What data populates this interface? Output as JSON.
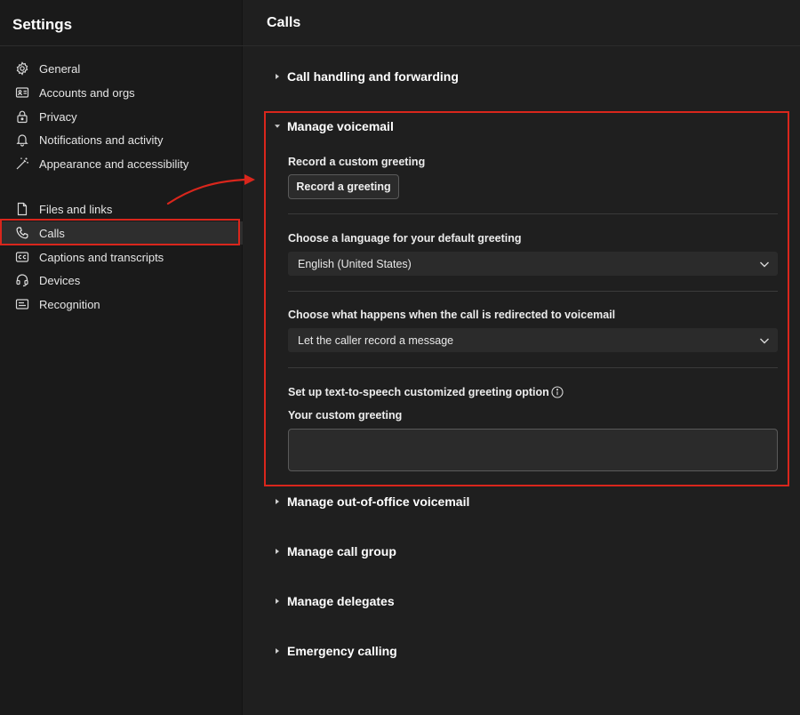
{
  "sidebar": {
    "title": "Settings",
    "group1": [
      {
        "label": "General",
        "icon": "gear-icon"
      },
      {
        "label": "Accounts and orgs",
        "icon": "id-card-icon"
      },
      {
        "label": "Privacy",
        "icon": "lock-icon"
      },
      {
        "label": "Notifications and activity",
        "icon": "bell-icon"
      },
      {
        "label": "Appearance and accessibility",
        "icon": "magic-wand-icon"
      }
    ],
    "group2": [
      {
        "label": "Files and links",
        "icon": "file-icon"
      },
      {
        "label": "Calls",
        "icon": "phone-icon",
        "selected": true
      },
      {
        "label": "Captions and transcripts",
        "icon": "cc-icon"
      },
      {
        "label": "Devices",
        "icon": "headset-icon"
      },
      {
        "label": "Recognition",
        "icon": "recognition-icon"
      }
    ]
  },
  "main": {
    "title": "Calls",
    "sections": {
      "call_handling": "Call handling and forwarding",
      "voicemail": "Manage voicemail",
      "out_of_office": "Manage out-of-office voicemail",
      "call_group": "Manage call group",
      "delegates": "Manage delegates",
      "emergency": "Emergency calling"
    },
    "voicemail": {
      "record_label": "Record a custom greeting",
      "record_button": "Record a greeting",
      "language_label": "Choose a language for your default greeting",
      "language_value": "English (United States)",
      "redirect_label": "Choose what happens when the call is redirected to voicemail",
      "redirect_value": "Let the caller record a message",
      "tts_label": "Set up text-to-speech customized greeting option",
      "custom_greeting_label": "Your custom greeting",
      "custom_greeting_value": ""
    }
  },
  "colors": {
    "annotation_red": "#d9261c",
    "background": "#1f1f1f",
    "sidebar_bg": "#1a1a1a"
  }
}
